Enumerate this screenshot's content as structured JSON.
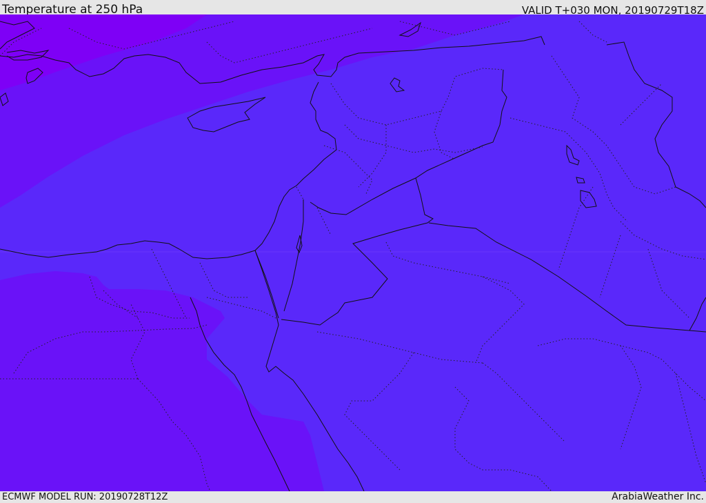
{
  "header": {
    "title": "Temperature at 250 hPa",
    "valid": "VALID T+030 MON, 20190729T18Z"
  },
  "footer": {
    "model_run": "ECMWF MODEL RUN: 20190728T12Z",
    "credit": "ArabiaWeather Inc."
  },
  "map": {
    "colors": {
      "coldest": "#7e00f6",
      "colder": "#6c0ff8",
      "cold": "#5b28fa",
      "base": "#5a28fa",
      "outline": "#111111",
      "border_dotted": "#333333"
    },
    "icons": [
      "coastline-outline",
      "country-border-line",
      "province-border-dotted"
    ]
  }
}
